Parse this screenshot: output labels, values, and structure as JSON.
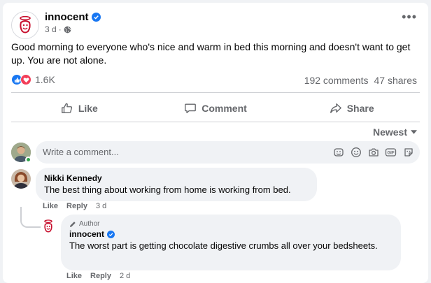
{
  "post": {
    "page_name": "innocent",
    "time": "3 d",
    "text": "Good morning to everyone who's nice and warm in bed this morning and doesn't want to get up. You are not alone.",
    "reaction_count": "1.6K",
    "comments_count": "192 comments",
    "shares_count": "47 shares"
  },
  "actions": {
    "like": "Like",
    "comment": "Comment",
    "share": "Share"
  },
  "sort": {
    "label": "Newest"
  },
  "composer": {
    "placeholder": "Write a comment..."
  },
  "comments": [
    {
      "name": "Nikki Kennedy",
      "text": "The best thing about working from home is working from bed.",
      "like": "Like",
      "reply": "Reply",
      "time": "3 d"
    }
  ],
  "reply": {
    "badge": "Author",
    "name": "innocent",
    "text": "The worst part is getting chocolate digestive crumbs all over your bedsheets.",
    "like": "Like",
    "reply": "Reply",
    "time": "2 d"
  },
  "colors": {
    "accent": "#1877f2",
    "muted": "#65676b",
    "brand_red": "#c8102e"
  },
  "icons": [
    "verified-icon",
    "globe-icon",
    "more-icon",
    "like-icon",
    "comment-icon",
    "share-icon",
    "sticker-icon",
    "emoji-icon",
    "camera-icon",
    "gif-icon",
    "avatar-sticker-icon",
    "pencil-icon",
    "chevron-down-icon"
  ]
}
